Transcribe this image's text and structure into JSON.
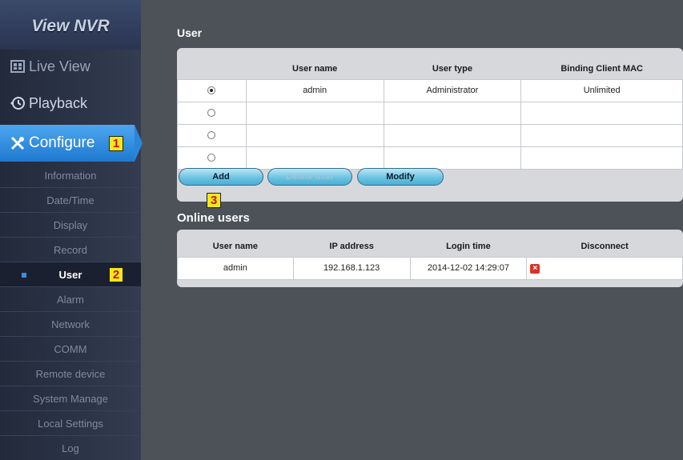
{
  "sidebar": {
    "brand": "View NVR",
    "main_nav": [
      {
        "label": "Live View",
        "icon": "live-view-icon"
      },
      {
        "label": "Playback",
        "icon": "playback-icon"
      },
      {
        "label": "Configure",
        "icon": "wrench-screwdriver-icon",
        "active": true
      }
    ],
    "sub_nav": [
      "Information",
      "Date/Time",
      "Display",
      "Record",
      "User",
      "Alarm",
      "Network",
      "COMM",
      "Remote device",
      "System Manage",
      "Local Settings",
      "Log"
    ],
    "active_sub": "User"
  },
  "annotations": {
    "configure": "1",
    "user": "2",
    "add": "3"
  },
  "user_section": {
    "title": "User",
    "columns": [
      "User name",
      "User type",
      "Binding Client MAC"
    ],
    "rows": [
      {
        "selected": true,
        "user_name": "admin",
        "user_type": "Administrator",
        "binding_mac": "Unlimited"
      },
      {
        "selected": false,
        "user_name": "",
        "user_type": "",
        "binding_mac": ""
      },
      {
        "selected": false,
        "user_name": "",
        "user_type": "",
        "binding_mac": ""
      },
      {
        "selected": false,
        "user_name": "",
        "user_type": "",
        "binding_mac": ""
      }
    ],
    "buttons": {
      "add": "Add",
      "delete": "Delete user",
      "modify": "Modify"
    }
  },
  "online_section": {
    "title": "Online users",
    "columns": [
      "User name",
      "IP address",
      "Login time",
      "Disconnect"
    ],
    "rows": [
      {
        "user_name": "admin",
        "ip_address": "192.168.1.123",
        "login_time": "2014-12-02 14:29:07",
        "disconnect_icon": "close-icon"
      }
    ]
  },
  "colors": {
    "accent": "#2a86d8",
    "badge": "#f3e818",
    "badge_text": "#c8101a",
    "delete": "#d8342a"
  }
}
